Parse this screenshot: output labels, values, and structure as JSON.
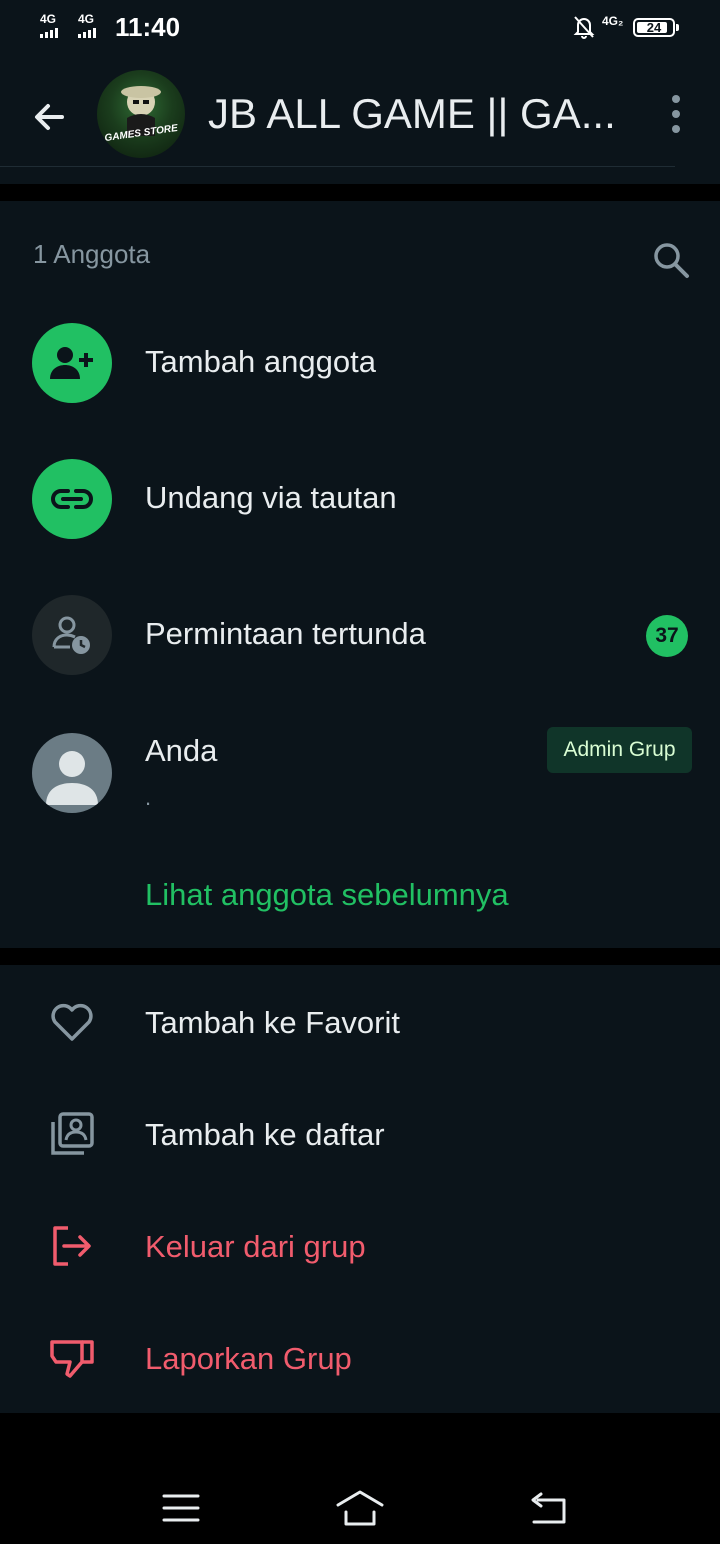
{
  "status_bar": {
    "network_1": "4G",
    "network_2": "4G",
    "time": "11:40",
    "network_right": "4G₂",
    "battery": "24",
    "icons": [
      "signal-icon",
      "signal-icon",
      "bell-off-icon",
      "battery-icon"
    ]
  },
  "header": {
    "title": "JB ALL GAME || GA...",
    "avatar_text": "GAMES STORE",
    "icons": [
      "back-arrow-icon",
      "more-vert-icon"
    ]
  },
  "members": {
    "count_label": "1 Anggota",
    "add_member_label": "Tambah anggota",
    "invite_link_label": "Undang via tautan",
    "pending_label": "Permintaan tertunda",
    "pending_count": "37",
    "member": {
      "name": "Anda",
      "status": ".",
      "role_badge": "Admin Grup"
    },
    "see_previous_label": "Lihat anggota sebelumnya",
    "icons": [
      "search-icon",
      "add-person-icon",
      "link-icon",
      "person-clock-icon",
      "user-avatar-icon"
    ]
  },
  "actions": {
    "favorite_label": "Tambah ke Favorit",
    "add_list_label": "Tambah ke daftar",
    "exit_label": "Keluar dari grup",
    "report_label": "Laporkan Grup",
    "icons": [
      "heart-icon",
      "list-icon",
      "exit-icon",
      "thumbs-down-icon"
    ]
  },
  "colors": {
    "accent_green": "#21c063",
    "danger_red": "#f15c6d",
    "background": "#0b141a",
    "text_primary": "#e9edef",
    "text_secondary": "#8696a0"
  }
}
